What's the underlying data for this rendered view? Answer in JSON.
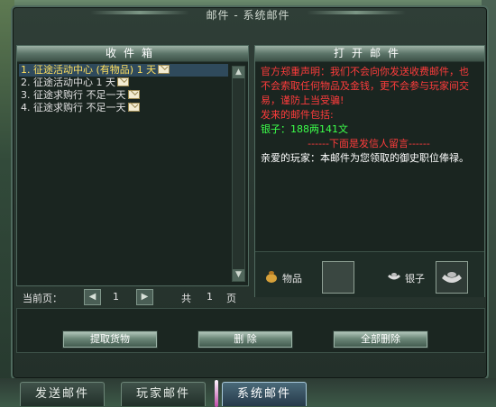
{
  "window": {
    "title": "邮件 - 系统邮件"
  },
  "inbox": {
    "header": "收件箱",
    "items": [
      {
        "index": "1.",
        "sender": "征途活动中心",
        "tag": "(有物品)",
        "expires": "1 天"
      },
      {
        "index": "2.",
        "sender": "征途活动中心",
        "tag": "",
        "expires": "1 天"
      },
      {
        "index": "3.",
        "sender": "征途求购行",
        "tag": "",
        "expires": "不足一天"
      },
      {
        "index": "4.",
        "sender": "征途求购行",
        "tag": "",
        "expires": "不足一天"
      }
    ],
    "pager": {
      "current_label": "当前页：",
      "current_page": "1",
      "total_label_prefix": "共",
      "total_pages": "1",
      "total_label_suffix": "页"
    }
  },
  "reader": {
    "header": "打开邮件",
    "disclaimer": "官方郑重声明：我们不会向你发送收费邮件，也不会索取任何物品及金钱，更不会参与玩家间交易，谨防上当受骗!",
    "content_title": "发来的邮件包括:",
    "silver_line": "银子：188两141文",
    "separator": "------下面是发信人留言------",
    "message": "亲爱的玩家：本邮件为您领取的御史职位俸禄。",
    "attach": {
      "items_label": "物品",
      "silver_label": "银子"
    }
  },
  "actions": {
    "take_goods": "提取货物",
    "delete": "删  除",
    "delete_all": "全部删除"
  },
  "tabs": [
    {
      "label": "发送邮件",
      "active": false
    },
    {
      "label": "玩家邮件",
      "active": false
    },
    {
      "label": "系统邮件",
      "active": true
    }
  ],
  "colors": {
    "selected_text": "#ffe060",
    "warning": "#ff3c3c",
    "highlight": "#3cff4a"
  }
}
